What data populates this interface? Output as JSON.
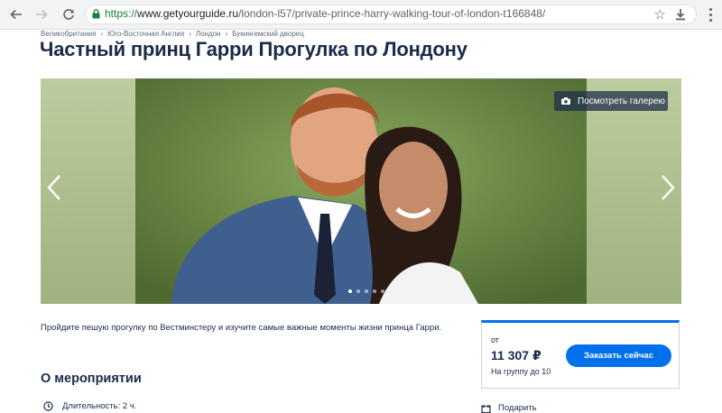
{
  "browser": {
    "url_protocol": "https://",
    "url_host": "www.getyourguide.ru",
    "url_path": "/london-l57/private-prince-harry-walking-tour-of-london-t166848/"
  },
  "breadcrumb": [
    "Великобритания",
    "Юго-Восточная Англия",
    "Лондон",
    "Букингемский дворец"
  ],
  "breadcrumb_separator": "›",
  "title": "Частный принц Гарри Прогулка по Лондону",
  "gallery": {
    "button_label": "Посмотреть галерею",
    "photo": "portrait-couple",
    "active_slide": 1,
    "slide_count": 5
  },
  "description": "Пройдите пешую прогулку по Вестминстеру и изучите самые важные моменты жизни принца Гарри.",
  "about_heading": "О мероприятии",
  "duration_label": "Длительность: 2 ч.",
  "booking": {
    "from_label": "от",
    "price": "11 307 ₽",
    "per_group": "На группу до 10",
    "book_button": "Заказать сейчас",
    "accent_color": "#0071eb"
  },
  "gift_label": "Подарить",
  "icons": [
    "back-icon",
    "forward-icon",
    "reload-icon",
    "lock-icon",
    "star-icon",
    "download-icon",
    "menu-icon",
    "camera-icon",
    "chevron-left-icon",
    "chevron-right-icon",
    "clock-icon",
    "gift-icon"
  ]
}
